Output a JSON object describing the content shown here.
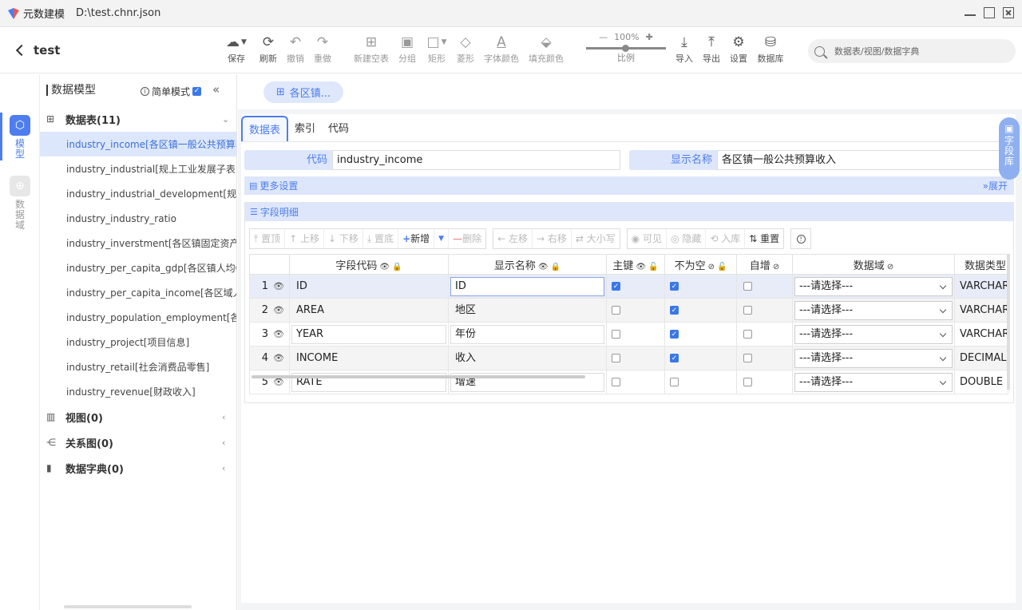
{
  "window": {
    "app_name": "元数建模",
    "file_path": "D:\\test.chnr.json"
  },
  "toolbar": {
    "project": "test",
    "tools": [
      {
        "label": "保存",
        "icon": "cloud-upload-icon",
        "glyph": "☁"
      },
      {
        "label": "刷新",
        "icon": "refresh-icon",
        "glyph": "⟳"
      },
      {
        "label": "撤销",
        "icon": "undo-icon",
        "glyph": "↶"
      },
      {
        "label": "重做",
        "icon": "redo-icon",
        "glyph": "↷"
      },
      {
        "label": "新建空表",
        "icon": "new-table-icon",
        "glyph": "⊞"
      },
      {
        "label": "分组",
        "icon": "group-icon",
        "glyph": "▣"
      },
      {
        "label": "矩形",
        "icon": "rectangle-icon",
        "glyph": "□"
      },
      {
        "label": "菱形",
        "icon": "diamond-icon",
        "glyph": "◇"
      },
      {
        "label": "字体颜色",
        "icon": "font-color-icon",
        "glyph": "A"
      },
      {
        "label": "填充颜色",
        "icon": "fill-color-icon",
        "glyph": "⬙"
      },
      {
        "label": "导入",
        "icon": "import-icon",
        "glyph": "⤓"
      },
      {
        "label": "导出",
        "icon": "export-icon",
        "glyph": "⤒"
      },
      {
        "label": "设置",
        "icon": "gear-icon",
        "glyph": "⚙"
      },
      {
        "label": "数据库",
        "icon": "database-icon",
        "glyph": "⛁"
      }
    ],
    "zoom": {
      "minus": "—",
      "value": "100%",
      "plus": "✚",
      "label": "比例"
    },
    "search_placeholder": "数据表/视图/数据字典"
  },
  "rail": {
    "model": "模型",
    "domain": "数据域"
  },
  "sidebar": {
    "title": "数据模型",
    "simple_mode": "简单模式",
    "tables_header": "数据表(11)",
    "tables": [
      "industry_income[各区镇一般公共预算收入]",
      "industry_industrial[规上工业发展子表]",
      "industry_industrial_development[规上工业发展]",
      "industry_industry_ratio",
      "industry_inverstment[各区镇固定资产投资]",
      "industry_per_capita_gdp[各区镇人均GDP]",
      "industry_per_capita_income[各区域人均可支配收入]",
      "industry_population_employment[各区镇人口就业]",
      "industry_project[项目信息]",
      "industry_retail[社会消费品零售]",
      "industry_revenue[财政收入]"
    ],
    "views": "视图(0)",
    "relations": "关系图(0)",
    "dicts": "数据字典(0)"
  },
  "main": {
    "chip": "各区镇...",
    "tabs": [
      "数据表",
      "索引",
      "代码"
    ],
    "code_label": "代码",
    "code_value": "industry_income",
    "display_label": "显示名称",
    "display_value": "各区镇一般公共预算收入",
    "more_settings": "更多设置",
    "expand": "展开",
    "field_detail": "字段明细",
    "field_lib": "字段库",
    "grid_buttons": {
      "top": "置顶",
      "up": "上移",
      "down": "下移",
      "bottom": "置底",
      "add": "新增",
      "del": "删除",
      "left": "左移",
      "right": "右移",
      "case": "大小写",
      "visible": "可见",
      "hidden": "隐藏",
      "to_lib": "入库",
      "reset": "重置"
    },
    "columns": [
      "字段代码",
      "显示名称",
      "主键",
      "不为空",
      "自增",
      "数据域",
      "数据类型"
    ],
    "rows": [
      {
        "n": "1",
        "code": "ID",
        "name": "ID",
        "pk": true,
        "nn": true,
        "ai": false,
        "domain": "---请选择---",
        "type": "VARCHAR"
      },
      {
        "n": "2",
        "code": "AREA",
        "name": "地区",
        "pk": false,
        "nn": true,
        "ai": false,
        "domain": "---请选择---",
        "type": "VARCHAR"
      },
      {
        "n": "3",
        "code": "YEAR",
        "name": "年份",
        "pk": false,
        "nn": true,
        "ai": false,
        "domain": "---请选择---",
        "type": "VARCHAR"
      },
      {
        "n": "4",
        "code": "INCOME",
        "name": "收入",
        "pk": false,
        "nn": true,
        "ai": false,
        "domain": "---请选择---",
        "type": "DECIMAL"
      },
      {
        "n": "5",
        "code": "RATE",
        "name": "增速",
        "pk": false,
        "nn": false,
        "ai": false,
        "domain": "---请选择---",
        "type": "DOUBLE"
      }
    ]
  }
}
